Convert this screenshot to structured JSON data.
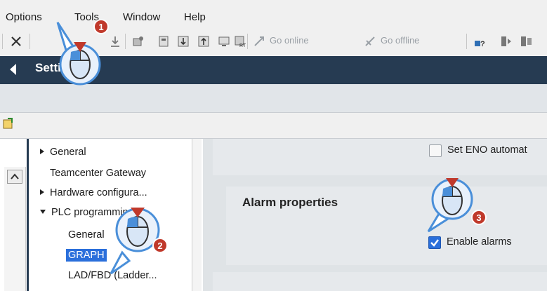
{
  "menu": {
    "options": "Options",
    "tools": "Tools",
    "window": "Window",
    "help": "Help"
  },
  "toolbar": {
    "go_online": "Go online",
    "go_offline": "Go offline"
  },
  "settings": {
    "title": "Settings"
  },
  "tree": {
    "items": [
      {
        "label": "General",
        "expander": "collapsed"
      },
      {
        "label": "Teamcenter Gateway",
        "expander": "none"
      },
      {
        "label": "Hardware configura...",
        "expander": "collapsed"
      },
      {
        "label": "PLC programming",
        "expander": "expanded"
      },
      {
        "label": "General",
        "expander": "none"
      },
      {
        "label": "GRAPH",
        "expander": "none",
        "selected": true
      },
      {
        "label": "LAD/FBD (Ladder...",
        "expander": "none"
      }
    ]
  },
  "panel": {
    "set_eno_label": "Set ENO automat",
    "alarm_properties_heading": "Alarm properties",
    "enable_alarms_label": "Enable alarms",
    "enable_alarms_checked": true,
    "set_eno_checked": false
  },
  "markers": {
    "step1": "1",
    "step2": "2",
    "step3": "3"
  },
  "colors": {
    "header_bg": "#263b52",
    "selection": "#2a6fdb",
    "marker_red": "#c0392b",
    "cursor_blue": "#4a8fd9"
  }
}
